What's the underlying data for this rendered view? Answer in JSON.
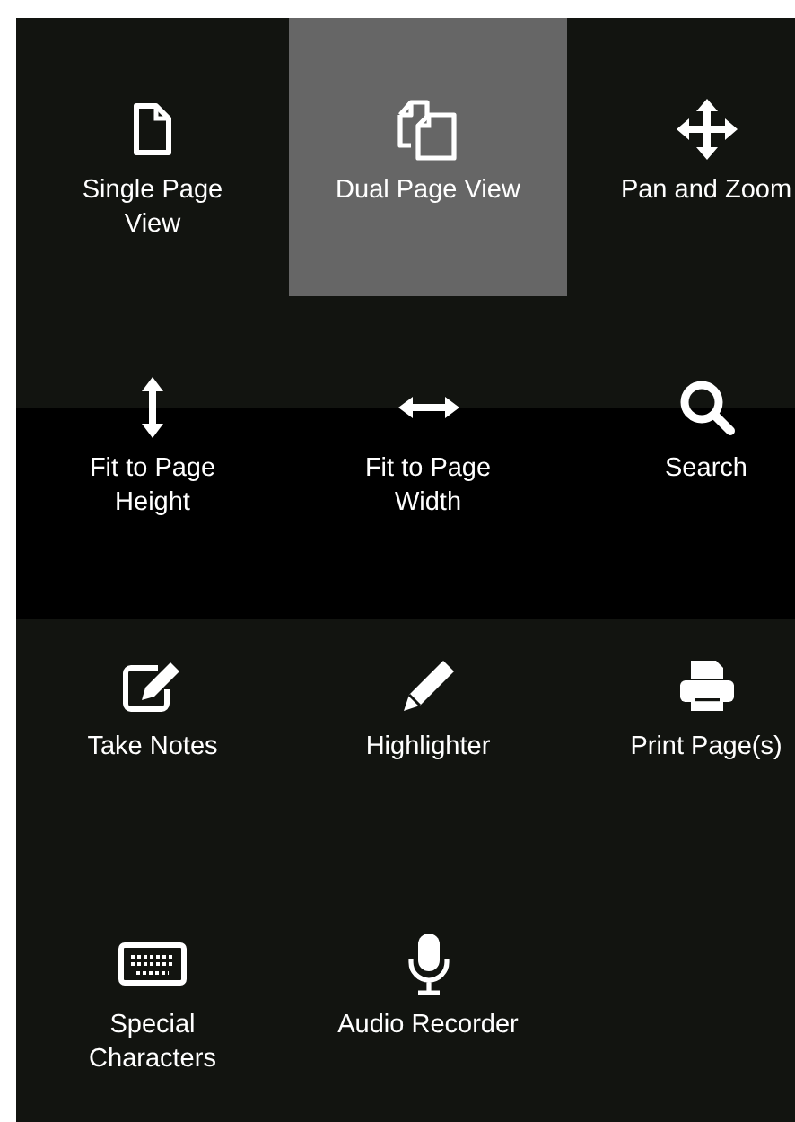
{
  "menu": {
    "items": [
      {
        "kind": "single-page",
        "label": "Single Page View",
        "selected": false
      },
      {
        "kind": "dual-page",
        "label": "Dual Page View",
        "selected": true
      },
      {
        "kind": "pan-zoom",
        "label": "Pan and Zoom",
        "selected": false
      },
      {
        "kind": "fit-height",
        "label": "Fit to Page Height",
        "selected": false
      },
      {
        "kind": "fit-width",
        "label": "Fit to Page Width",
        "selected": false
      },
      {
        "kind": "search",
        "label": "Search",
        "selected": false
      },
      {
        "kind": "notes",
        "label": "Take Notes",
        "selected": false
      },
      {
        "kind": "highlighter",
        "label": "Highlighter",
        "selected": false
      },
      {
        "kind": "print",
        "label": "Print Page(s)",
        "selected": false
      },
      {
        "kind": "keyboard",
        "label": "Special Characters",
        "selected": false
      },
      {
        "kind": "microphone",
        "label": "Audio Recorder",
        "selected": false
      }
    ]
  }
}
